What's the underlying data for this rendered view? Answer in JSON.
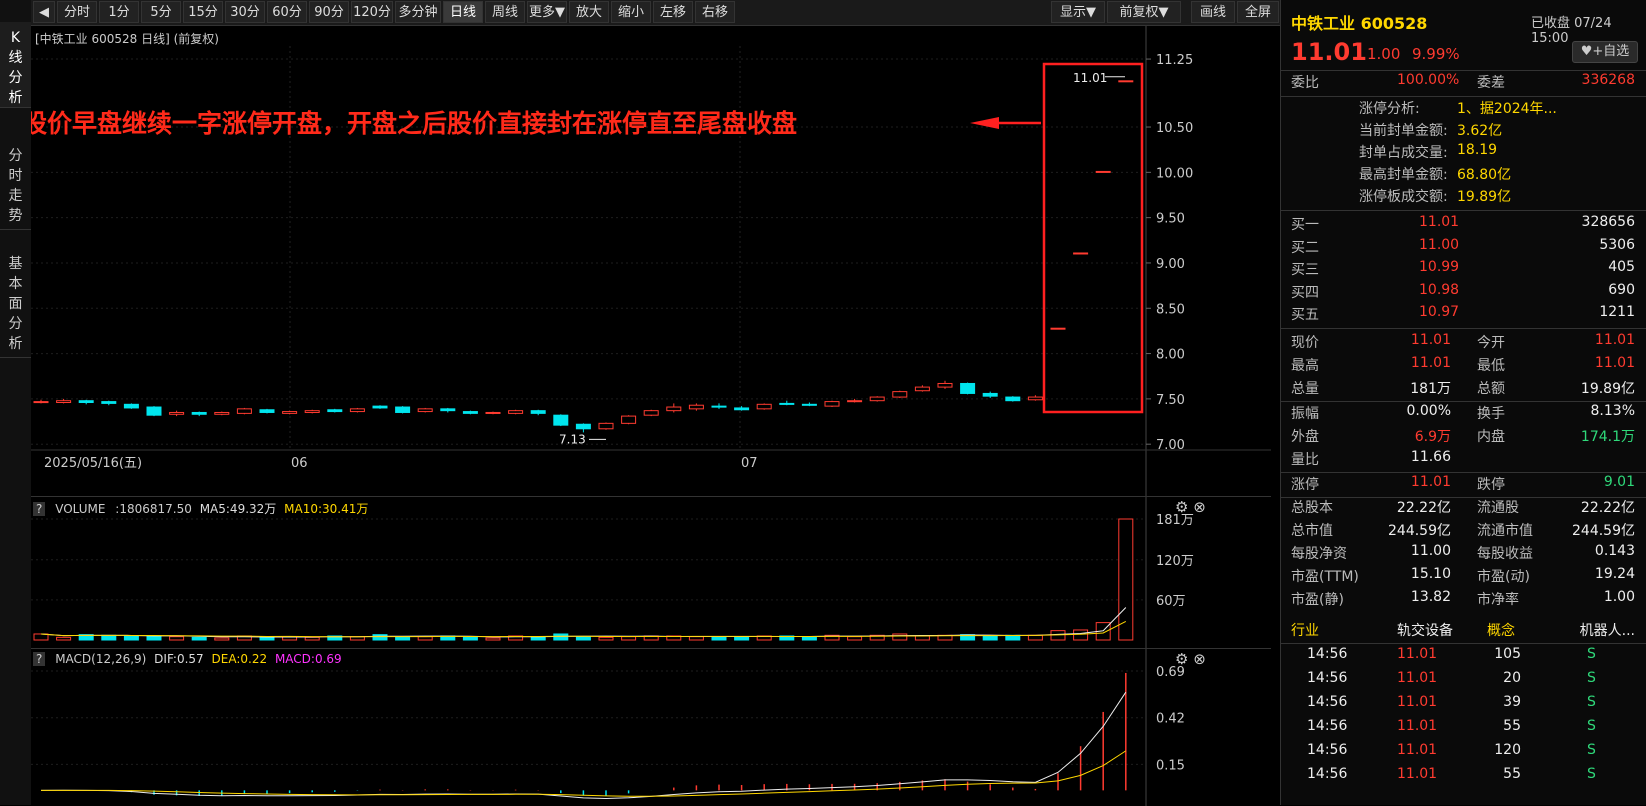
{
  "left_tabs": [
    "K\n线\n分\n析",
    "分\n时\n走\n势",
    "基\n本\n面\n分\n析"
  ],
  "toolbar": {
    "items": [
      "分时",
      "1分",
      "5分",
      "15分",
      "30分",
      "60分",
      "90分",
      "120分",
      "多分钟",
      "日线",
      "周线",
      "更多▼",
      "放大",
      "缩小",
      "左移",
      "右移"
    ],
    "active": "日线",
    "right_items": [
      "显示▼",
      "前复权▼",
      "画线",
      "全屏"
    ]
  },
  "kchart": {
    "header": "[中铁工业 600528 日线]  (前复权)",
    "price_ticks": [
      "11.25",
      "10.50",
      "10.00",
      "9.50",
      "9.00",
      "8.50",
      "8.00",
      "7.50",
      "7.00"
    ],
    "date_labels": [
      "2025/05/16(五)",
      "06",
      "07"
    ],
    "annotation": "股价早盘继续一字涨停开盘，开盘之后股价直接封在涨停直至尾盘收盘",
    "high_label": "11.01",
    "low_label": "7.13"
  },
  "volume": {
    "label": "VOLUME",
    "value": ":1806817.50",
    "ma5": "MA5:49.32万",
    "ma10": "MA10:30.41万",
    "ticks": [
      "181万",
      "120万",
      "60万"
    ]
  },
  "macd": {
    "label": "MACD(12,26,9)",
    "dif": "DIF:0.57",
    "dea": "DEA:0.22",
    "macd": "MACD:0.69",
    "ticks": [
      "0.69",
      "0.42",
      "0.15"
    ]
  },
  "chart_data": {
    "type": "candlestick",
    "candles": [
      {
        "o": 7.47,
        "c": 7.47,
        "h": 7.49,
        "l": 7.45
      },
      {
        "o": 7.46,
        "c": 7.48,
        "h": 7.5,
        "l": 7.45
      },
      {
        "o": 7.48,
        "c": 7.46,
        "h": 7.49,
        "l": 7.44
      },
      {
        "o": 7.47,
        "c": 7.45,
        "h": 7.48,
        "l": 7.43
      },
      {
        "o": 7.44,
        "c": 7.4,
        "h": 7.45,
        "l": 7.39
      },
      {
        "o": 7.41,
        "c": 7.32,
        "h": 7.42,
        "l": 7.31
      },
      {
        "o": 7.33,
        "c": 7.35,
        "h": 7.37,
        "l": 7.31
      },
      {
        "o": 7.35,
        "c": 7.33,
        "h": 7.36,
        "l": 7.31
      },
      {
        "o": 7.33,
        "c": 7.35,
        "h": 7.36,
        "l": 7.32
      },
      {
        "o": 7.34,
        "c": 7.39,
        "h": 7.4,
        "l": 7.33
      },
      {
        "o": 7.38,
        "c": 7.35,
        "h": 7.39,
        "l": 7.34
      },
      {
        "o": 7.34,
        "c": 7.36,
        "h": 7.37,
        "l": 7.33
      },
      {
        "o": 7.35,
        "c": 7.37,
        "h": 7.38,
        "l": 7.34
      },
      {
        "o": 7.38,
        "c": 7.36,
        "h": 7.39,
        "l": 7.35
      },
      {
        "o": 7.36,
        "c": 7.39,
        "h": 7.4,
        "l": 7.35
      },
      {
        "o": 7.42,
        "c": 7.4,
        "h": 7.43,
        "l": 7.39
      },
      {
        "o": 7.41,
        "c": 7.35,
        "h": 7.42,
        "l": 7.34
      },
      {
        "o": 7.36,
        "c": 7.39,
        "h": 7.4,
        "l": 7.35
      },
      {
        "o": 7.39,
        "c": 7.37,
        "h": 7.4,
        "l": 7.35
      },
      {
        "o": 7.36,
        "c": 7.34,
        "h": 7.37,
        "l": 7.33
      },
      {
        "o": 7.34,
        "c": 7.35,
        "h": 7.36,
        "l": 7.33
      },
      {
        "o": 7.34,
        "c": 7.37,
        "h": 7.38,
        "l": 7.33
      },
      {
        "o": 7.37,
        "c": 7.34,
        "h": 7.38,
        "l": 7.32
      },
      {
        "o": 7.32,
        "c": 7.21,
        "h": 7.33,
        "l": 7.2
      },
      {
        "o": 7.22,
        "c": 7.17,
        "h": 7.23,
        "l": 7.13
      },
      {
        "o": 7.17,
        "c": 7.23,
        "h": 7.24,
        "l": 7.16
      },
      {
        "o": 7.23,
        "c": 7.31,
        "h": 7.32,
        "l": 7.22
      },
      {
        "o": 7.32,
        "c": 7.37,
        "h": 7.38,
        "l": 7.31
      },
      {
        "o": 7.37,
        "c": 7.41,
        "h": 7.45,
        "l": 7.35
      },
      {
        "o": 7.39,
        "c": 7.43,
        "h": 7.45,
        "l": 7.37
      },
      {
        "o": 7.42,
        "c": 7.41,
        "h": 7.45,
        "l": 7.39
      },
      {
        "o": 7.4,
        "c": 7.38,
        "h": 7.42,
        "l": 7.37
      },
      {
        "o": 7.39,
        "c": 7.44,
        "h": 7.45,
        "l": 7.38
      },
      {
        "o": 7.45,
        "c": 7.44,
        "h": 7.48,
        "l": 7.43
      },
      {
        "o": 7.44,
        "c": 7.43,
        "h": 7.46,
        "l": 7.42
      },
      {
        "o": 7.42,
        "c": 7.47,
        "h": 7.48,
        "l": 7.41
      },
      {
        "o": 7.47,
        "c": 7.48,
        "h": 7.5,
        "l": 7.46
      },
      {
        "o": 7.48,
        "c": 7.52,
        "h": 7.53,
        "l": 7.47
      },
      {
        "o": 7.52,
        "c": 7.58,
        "h": 7.59,
        "l": 7.51
      },
      {
        "o": 7.59,
        "c": 7.63,
        "h": 7.65,
        "l": 7.58
      },
      {
        "o": 7.63,
        "c": 7.67,
        "h": 7.7,
        "l": 7.61
      },
      {
        "o": 7.67,
        "c": 7.56,
        "h": 7.68,
        "l": 7.55
      },
      {
        "o": 7.56,
        "c": 7.53,
        "h": 7.58,
        "l": 7.51
      },
      {
        "o": 7.52,
        "c": 7.48,
        "h": 7.53,
        "l": 7.47
      },
      {
        "o": 7.49,
        "c": 7.52,
        "h": 7.54,
        "l": 7.48
      },
      {
        "o": 8.28,
        "c": 8.28,
        "h": 8.28,
        "l": 8.28
      },
      {
        "o": 9.11,
        "c": 9.11,
        "h": 9.11,
        "l": 9.11
      },
      {
        "o": 10.01,
        "c": 10.01,
        "h": 10.01,
        "l": 10.01
      },
      {
        "o": 11.01,
        "c": 11.01,
        "h": 11.01,
        "l": 11.01
      }
    ],
    "volume": [
      9,
      4,
      8,
      7,
      6,
      6,
      5,
      4,
      3,
      6,
      4,
      5,
      4,
      6,
      5,
      8,
      5,
      5,
      6,
      4,
      3,
      6,
      5,
      9,
      5,
      4,
      5,
      6,
      6,
      5,
      4,
      5,
      6,
      6,
      5,
      7,
      5,
      7,
      9,
      6,
      7,
      8,
      6,
      7,
      7,
      14,
      15,
      26,
      181
    ],
    "ylim": [
      6.98,
      11.35
    ],
    "volume_ylim": [
      0,
      181
    ],
    "macd_ylim": [
      -0.05,
      0.69
    ]
  },
  "right": {
    "stock_name": "中铁工业 600528",
    "status": "已收盘 07/24 15:00",
    "price": "11.01",
    "change": "1.00",
    "pct": "9.99%",
    "watch": "+自选",
    "weibi_lbl": "委比",
    "weibi": "100.00%",
    "weicha_lbl": "委差",
    "weicha": "336268",
    "limit_analysis": [
      {
        "k": "涨停分析:",
        "v": "1、据2024年..."
      },
      {
        "k": "当前封单金额:",
        "v": "3.62亿"
      },
      {
        "k": "封单占成交量:",
        "v": "18.19"
      },
      {
        "k": "最高封单金额:",
        "v": "68.80亿"
      },
      {
        "k": "涨停板成交额:",
        "v": "19.89亿"
      }
    ],
    "bids": [
      {
        "k": "买一",
        "p": "11.01",
        "v": "328656"
      },
      {
        "k": "买二",
        "p": "11.00",
        "v": "5306"
      },
      {
        "k": "买三",
        "p": "10.99",
        "v": "405"
      },
      {
        "k": "买四",
        "p": "10.98",
        "v": "690"
      },
      {
        "k": "买五",
        "p": "10.97",
        "v": "1211"
      }
    ],
    "stats": [
      {
        "k1": "现价",
        "v1": "11.01",
        "c1": "red",
        "k2": "今开",
        "v2": "11.01",
        "c2": "red"
      },
      {
        "k1": "最高",
        "v1": "11.01",
        "c1": "red",
        "k2": "最低",
        "v2": "11.01",
        "c2": "red"
      },
      {
        "k1": "总量",
        "v1": "181万",
        "c1": "wht",
        "k2": "总额",
        "v2": "19.89亿",
        "c2": "wht"
      },
      {
        "k1": "振幅",
        "v1": "0.00%",
        "c1": "wht",
        "k2": "换手",
        "v2": "8.13%",
        "c2": "wht"
      },
      {
        "k1": "外盘",
        "v1": "6.9万",
        "c1": "red",
        "k2": "内盘",
        "v2": "174.1万",
        "c2": "grn"
      },
      {
        "k1": "量比",
        "v1": "11.66",
        "c1": "wht",
        "k2": "",
        "v2": "",
        "c2": "wht"
      },
      {
        "k1": "涨停",
        "v1": "11.01",
        "c1": "red",
        "k2": "跌停",
        "v2": "9.01",
        "c2": "grn"
      },
      {
        "k1": "总股本",
        "v1": "22.22亿",
        "c1": "wht",
        "k2": "流通股",
        "v2": "22.22亿",
        "c2": "wht"
      },
      {
        "k1": "总市值",
        "v1": "244.59亿",
        "c1": "wht",
        "k2": "流通市值",
        "v2": "244.59亿",
        "c2": "wht"
      },
      {
        "k1": "每股净资",
        "v1": "11.00",
        "c1": "wht",
        "k2": "每股收益",
        "v2": "0.143",
        "c2": "wht"
      },
      {
        "k1": "市盈(TTM)",
        "v1": "15.10",
        "c1": "wht",
        "k2": "市盈(动)",
        "v2": "19.24",
        "c2": "wht"
      },
      {
        "k1": "市盈(静)",
        "v1": "13.82",
        "c1": "wht",
        "k2": "市净率",
        "v2": "1.00",
        "c2": "wht"
      }
    ],
    "industry_lbl": "行业",
    "industry": "轨交设备",
    "concept_lbl": "概念",
    "concept": "机器人...",
    "ticks": [
      {
        "t": "14:56",
        "p": "11.01",
        "v": "105",
        "s": "S"
      },
      {
        "t": "14:56",
        "p": "11.01",
        "v": "20",
        "s": "S"
      },
      {
        "t": "14:56",
        "p": "11.01",
        "v": "39",
        "s": "S"
      },
      {
        "t": "14:56",
        "p": "11.01",
        "v": "55",
        "s": "S"
      },
      {
        "t": "14:56",
        "p": "11.01",
        "v": "120",
        "s": "S"
      },
      {
        "t": "14:56",
        "p": "11.01",
        "v": "55",
        "s": "S"
      }
    ]
  },
  "colors": {
    "up": "#ff3b30",
    "down": "#00e5ee",
    "annotation": "#ff2a1a"
  }
}
